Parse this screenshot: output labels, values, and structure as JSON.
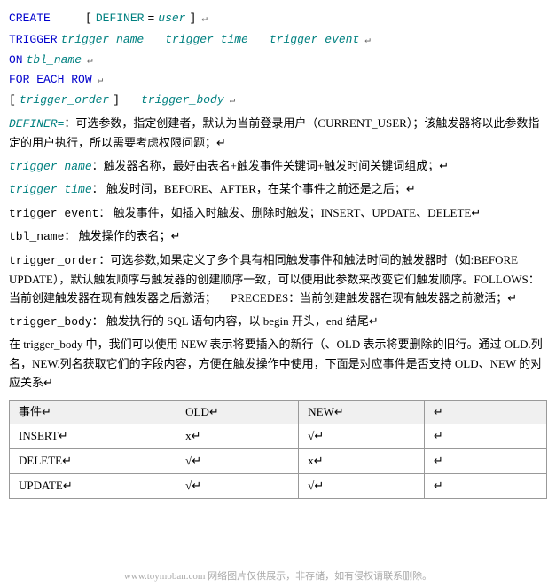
{
  "code": {
    "line1": {
      "create": "CREATE",
      "bracket_open": "[",
      "definer_label": "DEFINER",
      "eq": "=",
      "user": "user",
      "bracket_close": "]",
      "arrow": "↵"
    },
    "line2": {
      "trigger": "TRIGGER",
      "trigger_name": "trigger_name",
      "trigger_time": "trigger_time",
      "trigger_event": "trigger_event",
      "arrow": "↵"
    },
    "line3": {
      "on": "ON",
      "tbl_name": "tbl_name",
      "arrow": "↵"
    },
    "line4": {
      "for_each_row": "FOR EACH ROW",
      "arrow": "↵"
    },
    "line5": {
      "bracket_open": "[",
      "trigger_order": "trigger_order",
      "bracket_close": "]",
      "trigger_body": "trigger_body",
      "arrow": "↵"
    }
  },
  "descriptions": [
    {
      "term": "DEFINER=",
      "text": "：可选参数，指定创建者，默认为当前登录用户（CURRENT_USER）；该触发器将以此参数指定的用户执行，所以需要考虑权限问题；↵"
    },
    {
      "term": "trigger_name",
      "separator": "：",
      "text": "触发器名称，最好由表名+触发事件关键词+触发时间关键词组成；↵"
    },
    {
      "term": "trigger_time",
      "separator": "：",
      "text": "  触发时间，BEFORE、AFTER，在某个事件之前还是之后；↵"
    },
    {
      "term": "trigger_event",
      "separator": "：",
      "text": " 触发事件，如插入时触发、删除时触发；INSERT、UPDATE、DELETE↵"
    },
    {
      "term": "tbl_name",
      "separator": "：",
      "text": "  触发操作的表名；↵"
    },
    {
      "term": "trigger_order",
      "separator": "：",
      "text": "可选参数,如果定义了多个具有相同触发事件和触法时间的触发器时（如:BEFORE UPDATE），默认触发顺序与触发器的创建顺序一致，可以使用此参数来改变它们触发顺序。FOLLOWS：当前创建触发器在现有触发器之后激活；　　PRECEDES：当前创建触发器在现有触发器之前激活；↵"
    },
    {
      "term": "trigger_body",
      "separator": "：",
      "text": " 触发执行的 SQL 语句内容，以 begin 开头，end 结尾↵"
    }
  ],
  "para1": "在 trigger_body 中，我们可以使用 NEW 表示将要插入的新行（、OLD 表示将要删除的旧行。通过 OLD.列名，NEW.列名获取它们的字段内容，方便在触发操作中使用，下面是对应事件是否支持 OLD、NEW 的对应关系↵",
  "table": {
    "headers": [
      "事件↵",
      "OLD↵",
      "NEW↵",
      "↵"
    ],
    "rows": [
      [
        "INSERT↵",
        "x↵",
        "√↵",
        "↵"
      ],
      [
        "DELETE↵",
        "√↵",
        "x↵",
        "↵"
      ],
      [
        "UPDATE↵",
        "√↵",
        "√↵",
        "↵"
      ]
    ]
  },
  "watermark": "www.toymoban.com 网络图片仅供展示，非存储，如有侵权请联系删除。"
}
